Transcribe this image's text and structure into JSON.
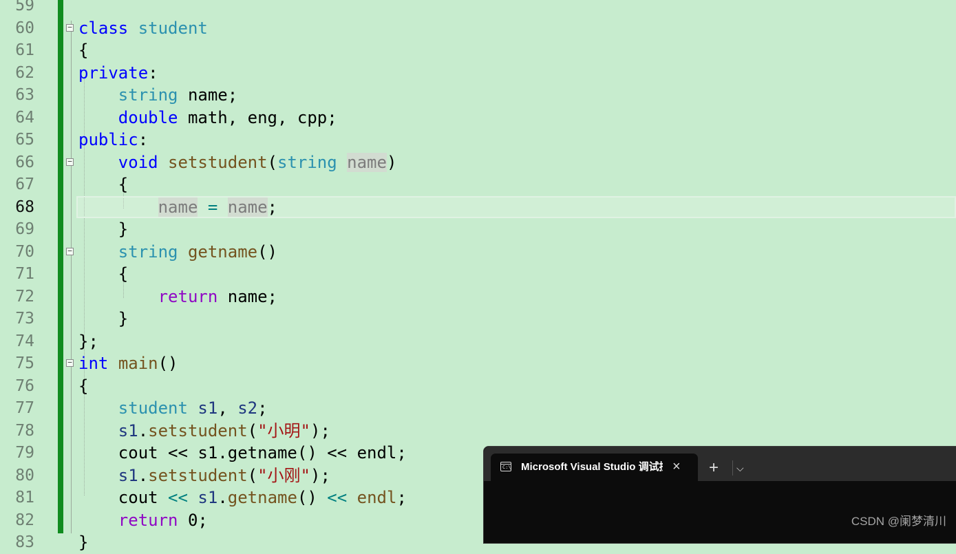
{
  "editor": {
    "lines": [
      {
        "n": "59"
      },
      {
        "n": "60"
      },
      {
        "n": "61"
      },
      {
        "n": "62"
      },
      {
        "n": "63"
      },
      {
        "n": "64"
      },
      {
        "n": "65"
      },
      {
        "n": "66"
      },
      {
        "n": "67"
      },
      {
        "n": "68"
      },
      {
        "n": "69"
      },
      {
        "n": "70"
      },
      {
        "n": "71"
      },
      {
        "n": "72"
      },
      {
        "n": "73"
      },
      {
        "n": "74"
      },
      {
        "n": "75"
      },
      {
        "n": "76"
      },
      {
        "n": "77"
      },
      {
        "n": "78"
      },
      {
        "n": "79"
      },
      {
        "n": "80"
      },
      {
        "n": "81"
      },
      {
        "n": "82"
      },
      {
        "n": "83"
      }
    ],
    "tokens": {
      "l60": [
        "class",
        "student"
      ],
      "l61": [
        "{"
      ],
      "l62": [
        "private",
        ":"
      ],
      "l63": [
        "string",
        "name;"
      ],
      "l64": [
        "double",
        "math, eng, cpp;"
      ],
      "l65": [
        "public",
        ":"
      ],
      "l66": [
        "void",
        "setstudent",
        "(",
        "string",
        "name",
        ")"
      ],
      "l67": [
        "{"
      ],
      "l68": [
        "name",
        "=",
        "name",
        ";"
      ],
      "l69": [
        "}"
      ],
      "l70": [
        "string",
        "getname",
        "()"
      ],
      "l71": [
        "{"
      ],
      "l72": [
        "return",
        "name;"
      ],
      "l73": [
        "}"
      ],
      "l74": [
        "};"
      ],
      "l75": [
        "int",
        "main",
        "()"
      ],
      "l76": [
        "{"
      ],
      "l77": [
        "student",
        "s1",
        ",",
        "s2",
        ";"
      ],
      "l78": [
        "s1",
        ".",
        "setstudent",
        "(",
        "\"小明\"",
        ");"
      ],
      "l79": [
        "cout << s1.getname() << endl;"
      ],
      "l80": [
        "s1",
        ".",
        "setstudent",
        "(",
        "\"小刚\"",
        ");"
      ],
      "l81": [
        "cout",
        "<<",
        "s1",
        ".",
        "getname",
        "()",
        "<<",
        "endl",
        ";"
      ],
      "l82": [
        "return",
        "0;"
      ],
      "l83": [
        "}"
      ]
    },
    "current_line": "68"
  },
  "terminal": {
    "tab_title": "Microsoft Visual Studio 调试控制台",
    "icon": "console-window-icon",
    "close_icon": "×",
    "new_tab_icon": "+",
    "dropdown_icon": "⌵"
  },
  "watermark": "CSDN @阑梦清川",
  "colors": {
    "editor_background": "#c7ecce",
    "keyword": "#0000ff",
    "type": "#2b91af",
    "function": "#74531f",
    "control": "#8f08c4",
    "string": "#a31515",
    "change_bar": "#108c1f"
  }
}
